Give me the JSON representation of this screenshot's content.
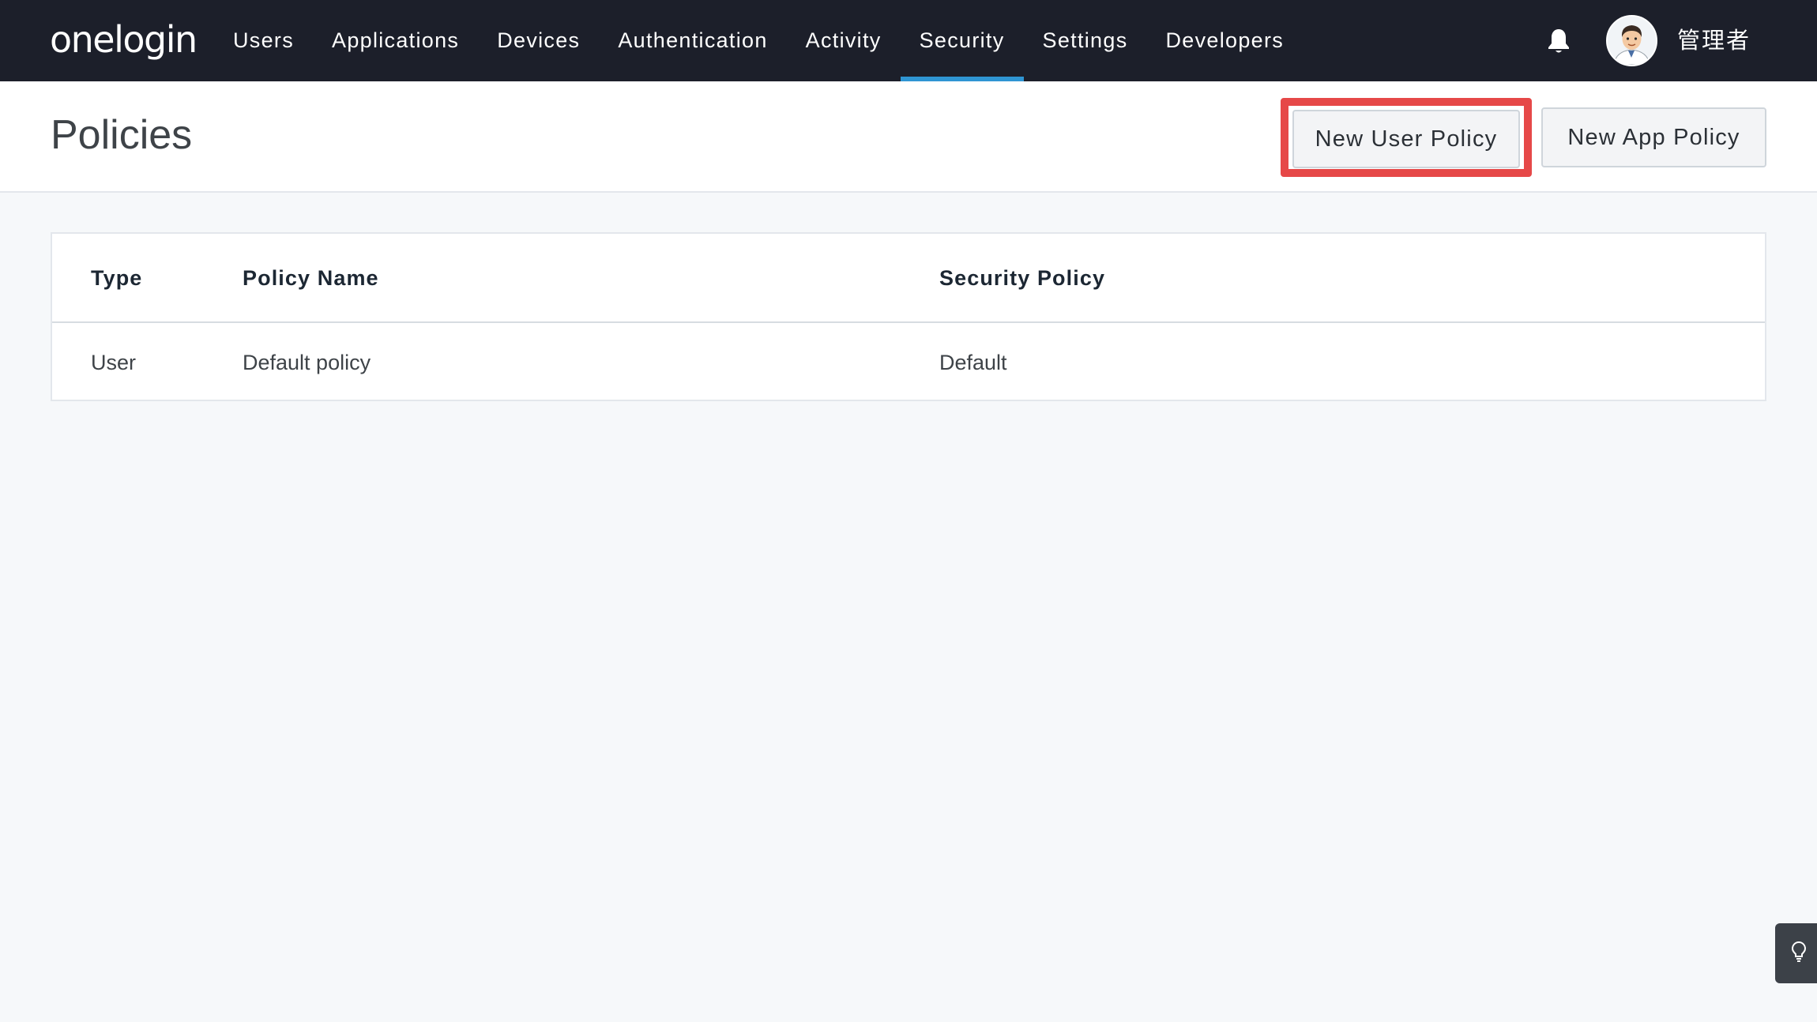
{
  "app": {
    "logo_text": "onelogin"
  },
  "nav": {
    "items": [
      {
        "label": "Users"
      },
      {
        "label": "Applications"
      },
      {
        "label": "Devices"
      },
      {
        "label": "Authentication"
      },
      {
        "label": "Activity"
      },
      {
        "label": "Security",
        "active": true
      },
      {
        "label": "Settings"
      },
      {
        "label": "Developers"
      }
    ],
    "active_accent_color": "#2f95d3"
  },
  "user": {
    "name": "管理者",
    "avatar_icon": "user-avatar"
  },
  "page": {
    "title": "Policies",
    "buttons": {
      "new_user_policy": "New User Policy",
      "new_app_policy": "New App Policy"
    },
    "highlight_color": "#e64848"
  },
  "table": {
    "columns": [
      "Type",
      "Policy Name",
      "Security Policy"
    ],
    "rows": [
      {
        "type": "User",
        "policy_name": "Default policy",
        "security_policy": "Default"
      }
    ]
  },
  "colors": {
    "topbar": "#1c1f2a",
    "background": "#f6f8fa"
  }
}
